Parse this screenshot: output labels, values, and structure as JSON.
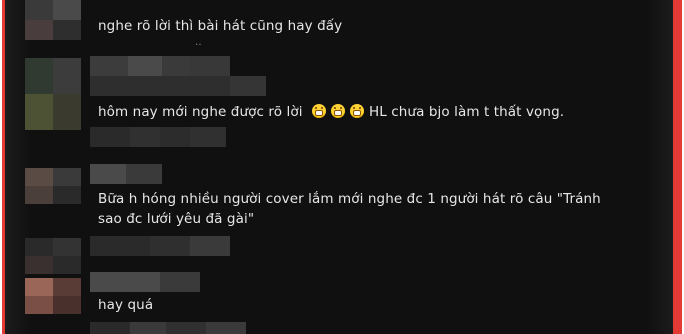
{
  "comments": [
    {
      "text": "nghe rõ lời thì bài hát cũng hay đấy"
    },
    {
      "text_before": "hôm nay mới nghe được rõ lời",
      "emoji_count": 3,
      "emoji_name": "grinning-face-icon",
      "text_after": "HL chưa bjo làm t thất vọng."
    },
    {
      "line1": "Bữa h hóng nhiều người cover lắm mới nghe đc 1 người hát rõ câu \"Tránh",
      "line2": "sao đc lưới yêu đã gài\""
    },
    {
      "text": "hay quá"
    }
  ],
  "colors": {
    "frame": "#e53935",
    "panel": "#101010",
    "text": "#e7e7e7",
    "emoji": "#ffd233"
  }
}
